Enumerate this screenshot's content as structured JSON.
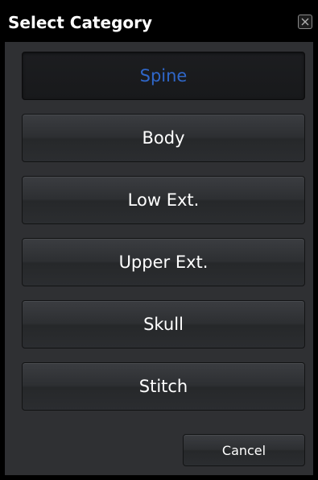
{
  "dialog": {
    "title": "Select Category",
    "close_icon": "close-x-icon"
  },
  "categories": [
    {
      "label": "Spine",
      "selected": true
    },
    {
      "label": "Body",
      "selected": false
    },
    {
      "label": "Low Ext.",
      "selected": false
    },
    {
      "label": "Upper Ext.",
      "selected": false
    },
    {
      "label": "Skull",
      "selected": false
    },
    {
      "label": "Stitch",
      "selected": false
    }
  ],
  "footer": {
    "cancel_label": "Cancel"
  },
  "colors": {
    "selected_text": "#2f67c9",
    "text": "#ffffff",
    "panel_bg": "#2f3033",
    "titlebar_bg": "#000000"
  }
}
